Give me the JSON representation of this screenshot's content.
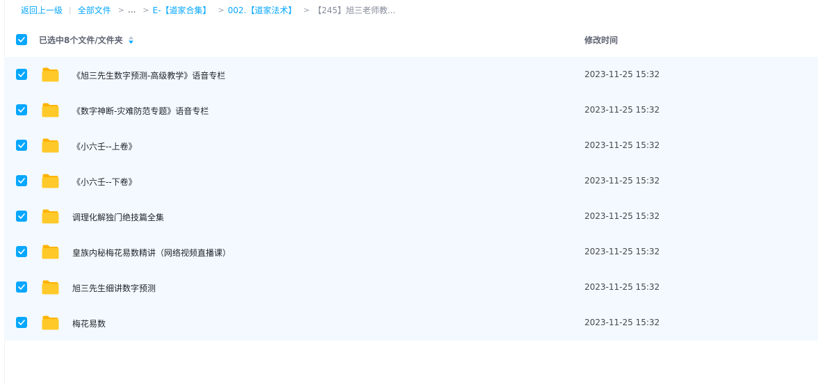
{
  "breadcrumb": {
    "back": "返回上一级",
    "pipe": "|",
    "all_files": "全部文件",
    "sep": ">",
    "ellipsis": "...",
    "crumb1": "E-【道家合集】",
    "crumb2": "002.【道家法术】",
    "current": "【245】旭三老师教..."
  },
  "header": {
    "selected_label": "已选中8个文件/文件夹",
    "time_label": "修改时间"
  },
  "colors": {
    "accent": "#06a7ff",
    "row_selected_bg": "#f3f9fe",
    "folder": "#ffc21f"
  },
  "rows": [
    {
      "name": "《旭三先生数字预测-高级教学》语音专栏",
      "time": "2023-11-25 15:32",
      "icon": "folder-icon",
      "checked": true
    },
    {
      "name": "《数字神断-灾难防范专题》语音专栏",
      "time": "2023-11-25 15:32",
      "icon": "folder-icon",
      "checked": true
    },
    {
      "name": "《小六壬--上卷》",
      "time": "2023-11-25 15:32",
      "icon": "folder-icon",
      "checked": true
    },
    {
      "name": "《小六壬--下卷》",
      "time": "2023-11-25 15:32",
      "icon": "folder-icon",
      "checked": true
    },
    {
      "name": "调理化解独门绝技篇全集",
      "time": "2023-11-25 15:32",
      "icon": "folder-icon",
      "checked": true
    },
    {
      "name": "皇族内秘梅花易数精讲（网络视频直播课）",
      "time": "2023-11-25 15:32",
      "icon": "folder-icon",
      "checked": true
    },
    {
      "name": "旭三先生细讲数字预测",
      "time": "2023-11-25 15:32",
      "icon": "folder-icon",
      "checked": true
    },
    {
      "name": "梅花易数",
      "time": "2023-11-25 15:32",
      "icon": "folder-icon",
      "checked": true
    }
  ]
}
